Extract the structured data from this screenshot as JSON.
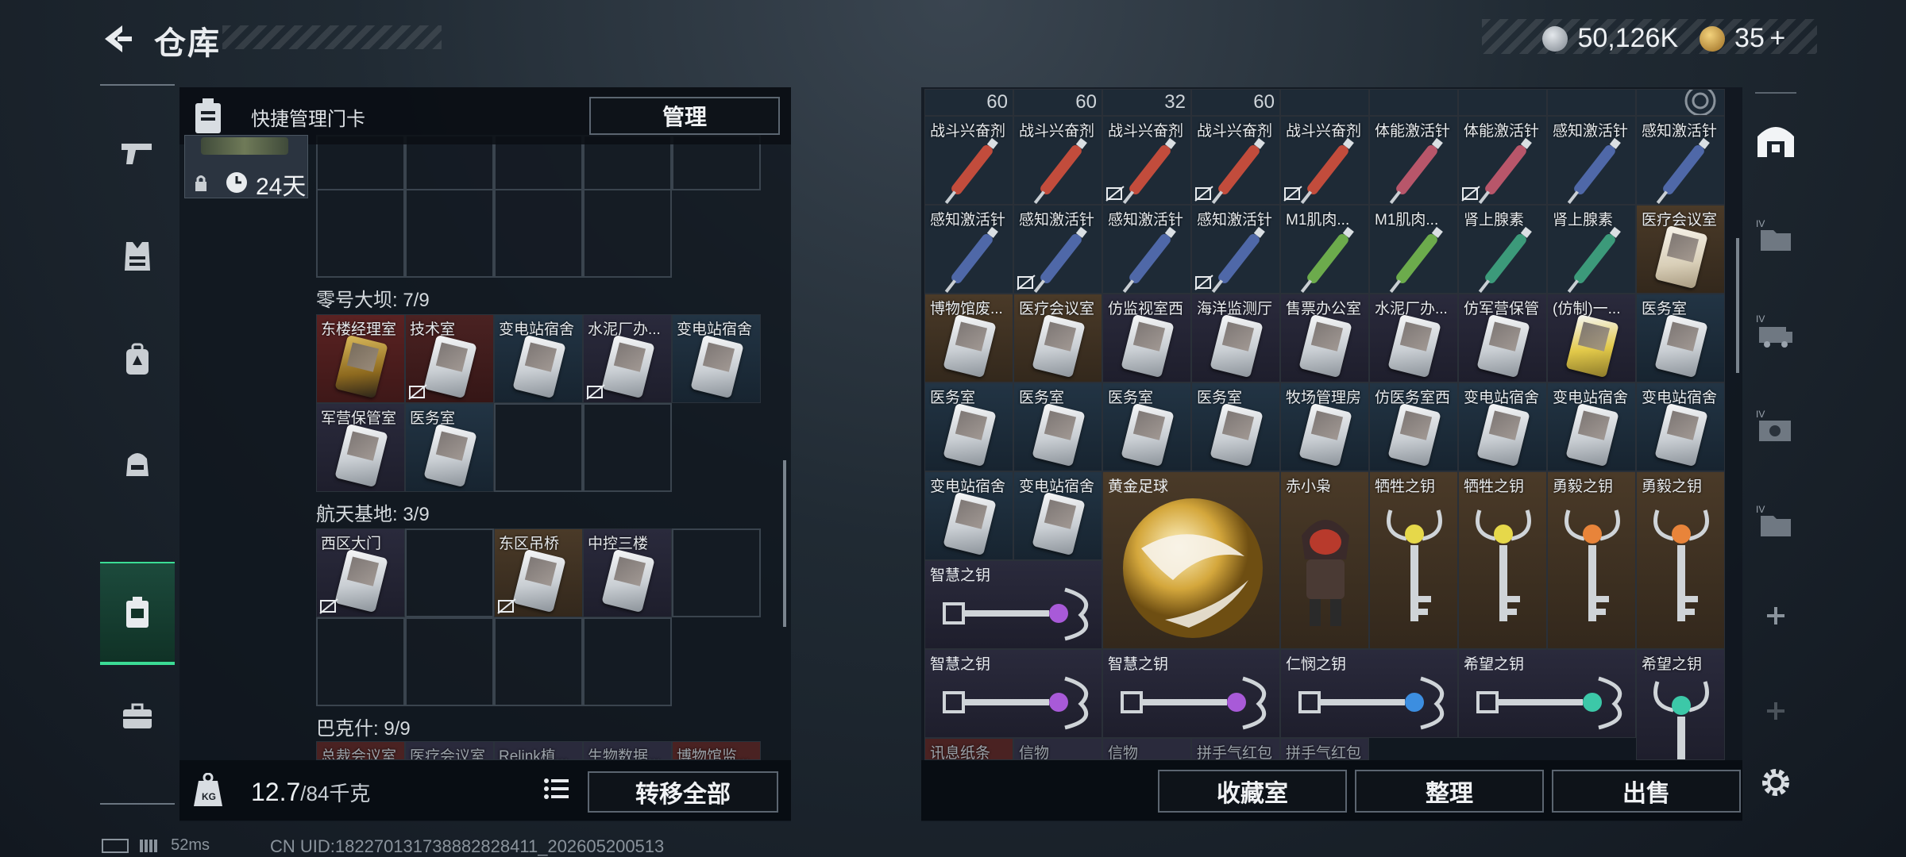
{
  "header": {
    "title": "仓库",
    "currency_amount": "50,126K",
    "tickets_amount": "35",
    "tickets_plus": "+",
    "colors": {
      "accent": "#3bdc95",
      "coin": "#9aa3ad",
      "ticket": "#d9a84a"
    }
  },
  "left_nav": {
    "items": [
      {
        "name": "weapons",
        "icon": "pistol-icon"
      },
      {
        "name": "armor",
        "icon": "vest-icon"
      },
      {
        "name": "backpack",
        "icon": "backpack-icon"
      },
      {
        "name": "gear",
        "icon": "helmet-bag-icon"
      },
      {
        "name": "keycards",
        "icon": "keycard-icon",
        "active": true
      },
      {
        "name": "case",
        "icon": "briefcase-icon"
      }
    ]
  },
  "left_panel": {
    "quick_label": "快捷管理门卡",
    "manage_button": "管理",
    "key_days": "24天",
    "sections": [
      {
        "title": "零号大坝: 7/9",
        "cards": [
          "东楼经理室",
          "技术室",
          "变电站宿舍",
          "水泥厂办...",
          "变电站宿舍",
          "军营保管室",
          "医务室"
        ]
      },
      {
        "title": "航天基地: 3/9",
        "cards": [
          "西区大门",
          "东区吊桥",
          "中控三楼"
        ]
      },
      {
        "title": "巴克什: 9/9",
        "cards": [
          "总裁会议室",
          "医疗会议室",
          "Relink植...",
          "生物数据...",
          "博物馆监..."
        ]
      }
    ],
    "weight_current": "12.7",
    "weight_total": "/84千克",
    "transfer_all": "转移全部"
  },
  "right_panel": {
    "top_counts": [
      "60",
      "60",
      "32",
      "60"
    ],
    "rows": [
      [
        "战斗兴奋剂",
        "战斗兴奋剂",
        "战斗兴奋剂",
        "战斗兴奋剂",
        "战斗兴奋剂",
        "体能激活针",
        "体能激活针",
        "感知激活针",
        "感知激活针"
      ],
      [
        "感知激活针",
        "感知激活针",
        "感知激活针",
        "感知激活针",
        "M1肌肉...",
        "M1肌肉...",
        "肾上腺素",
        "肾上腺素",
        "医疗会议室"
      ],
      [
        "博物馆废...",
        "医疗会议室",
        "仿监视室西",
        "海洋监测厅",
        "售票办公室",
        "水泥厂办...",
        "仿军营保管",
        "(仿制)一...",
        "医务室"
      ],
      [
        "医务室",
        "医务室",
        "医务室",
        "医务室",
        "牧场管理房",
        "仿医务室西",
        "变电站宿舍",
        "变电站宿舍",
        "变电站宿舍"
      ]
    ],
    "row5": {
      "cards": [
        "变电站宿舍",
        "变电站宿舍"
      ],
      "ball": "黄金足球",
      "figure": "赤小枭",
      "keys": [
        "牺牲之钥",
        "牺牲之钥",
        "勇毅之钥",
        "勇毅之钥"
      ]
    },
    "row6_key": "智慧之钥",
    "row7": [
      "智慧之钥",
      "智慧之钥",
      "仁悯之钥",
      "希望之钥",
      "希望之钥"
    ],
    "row8_partial": [
      "讯息纸条",
      "信物",
      "信物",
      "拼手气红包",
      "拼手气红包"
    ],
    "buttons": {
      "vault": "收藏室",
      "sort": "整理",
      "sell": "出售"
    }
  },
  "status": {
    "latency": "52ms",
    "uid": "CN UID:182270131738882828411_202605200513"
  }
}
